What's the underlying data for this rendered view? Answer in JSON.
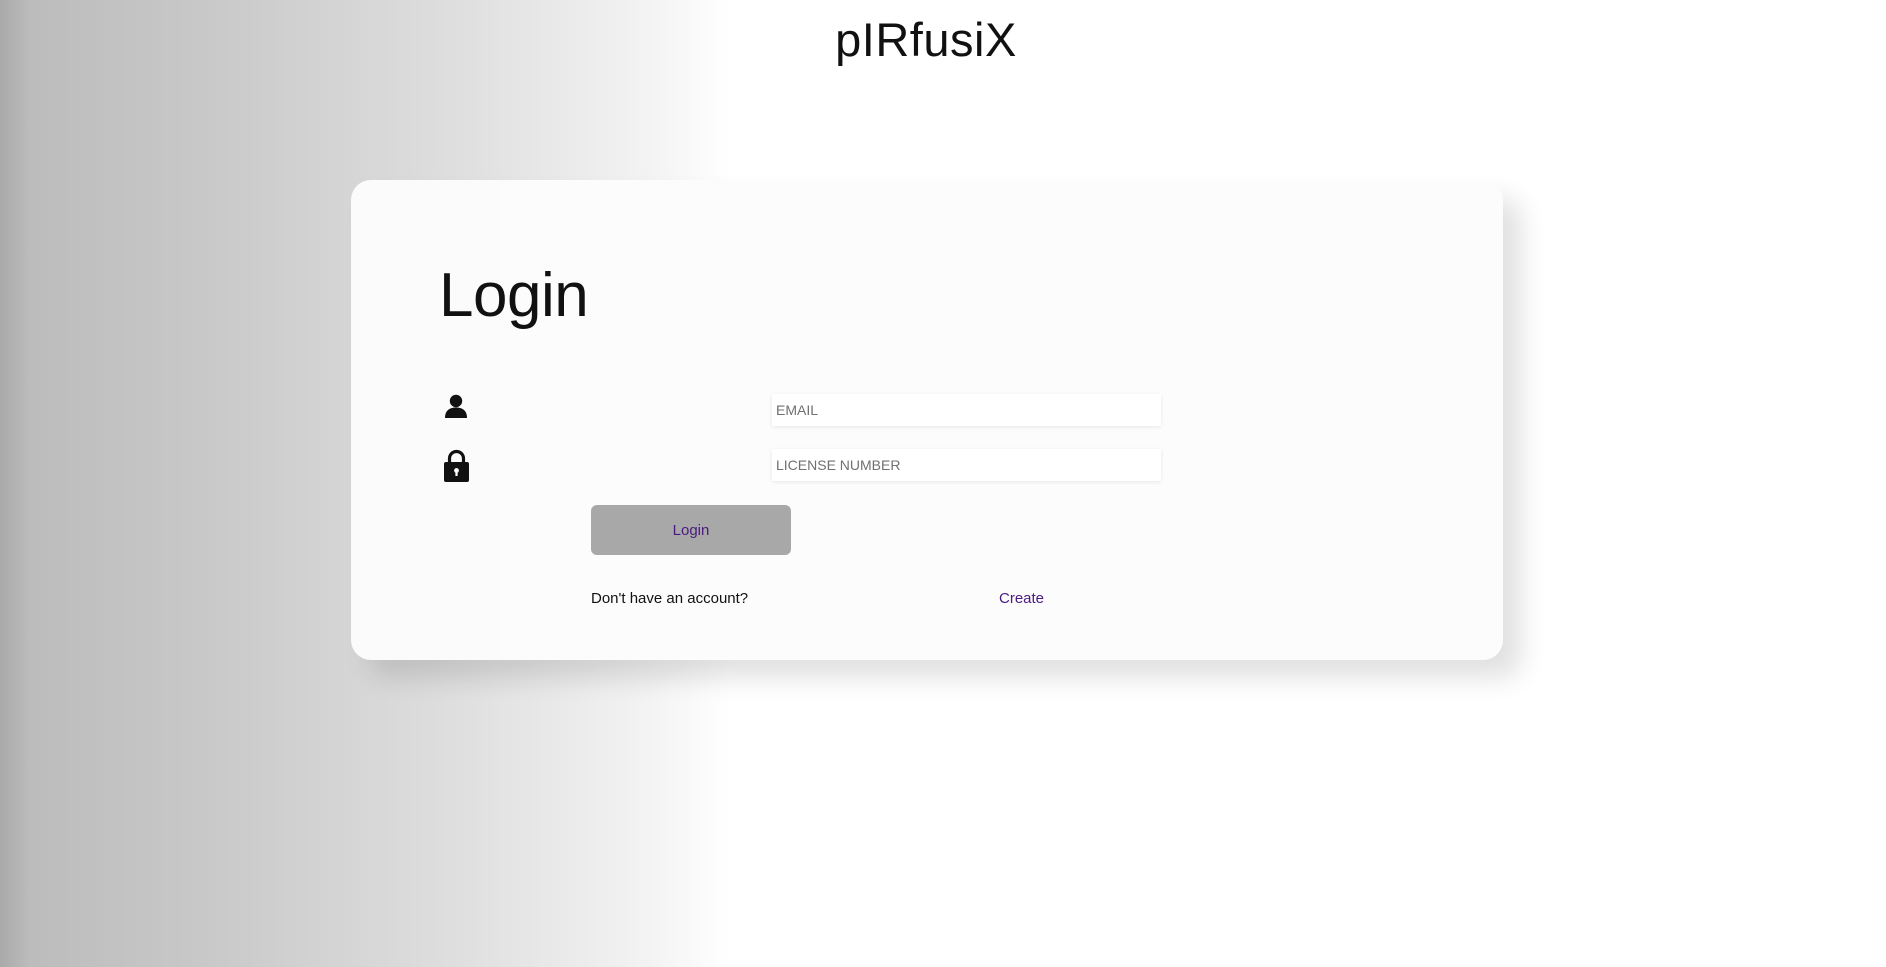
{
  "app": {
    "title": "pIRfusiX"
  },
  "login_card": {
    "heading": "Login",
    "email": {
      "icon": "user-icon",
      "placeholder": "EMAIL",
      "value": ""
    },
    "license": {
      "icon": "lock-icon",
      "placeholder": "LICENSE NUMBER",
      "value": ""
    },
    "submit_label": "Login",
    "signup_prompt": "Don't have an account?",
    "create_label": "Create"
  },
  "colors": {
    "accent_text": "#4b1a7f",
    "button_background": "#a8a8a8",
    "card_background": "#fcfcfc"
  }
}
